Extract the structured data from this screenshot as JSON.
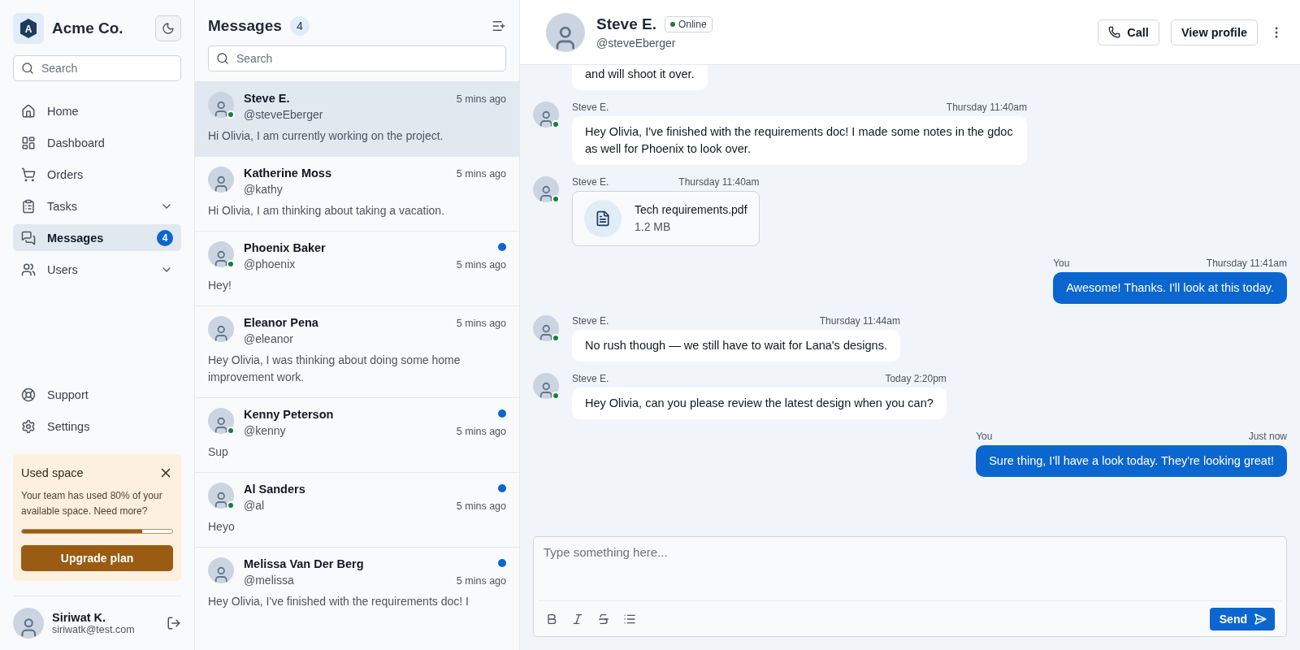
{
  "sidebar": {
    "logo_letter": "A",
    "brand": "Acme Co.",
    "search": {
      "placeholder": "Search"
    },
    "nav": [
      {
        "label": "Home",
        "selected": false
      },
      {
        "label": "Dashboard",
        "selected": false
      },
      {
        "label": "Orders",
        "selected": false
      },
      {
        "label": "Tasks",
        "selected": false,
        "expanded": false
      },
      {
        "label": "Messages",
        "selected": true,
        "badge": "4"
      },
      {
        "label": "Users",
        "selected": false,
        "expanded": false
      }
    ],
    "nav_bottom": [
      {
        "label": "Support",
        "selected": false
      },
      {
        "label": "Settings",
        "selected": false
      }
    ],
    "usage_card": {
      "title": "Used space",
      "text": "Your team has used 80% of your available space. Need more?",
      "level": 0.8,
      "button": "Upgrade plan"
    },
    "user": {
      "name": "Siriwat K.",
      "email": "siriwatk@test.com"
    }
  },
  "message_list": {
    "title": "Messages",
    "count": "4",
    "search": {
      "placeholder": "Search"
    },
    "conversations": [
      {
        "name": "Steve E.",
        "handle": "@steveEberger",
        "time": "5 mins ago",
        "preview": "Hi Olivia, I am currently working on the project.",
        "selected": true,
        "online": true,
        "unread": false
      },
      {
        "name": "Katherine Moss",
        "handle": "@kathy",
        "time": "5 mins ago",
        "preview": "Hi Olivia, I am thinking about taking a vacation.",
        "selected": false,
        "online": false,
        "unread": false
      },
      {
        "name": "Phoenix Baker",
        "handle": "@phoenix",
        "time": "5 mins ago",
        "preview": "Hey!",
        "selected": false,
        "online": true,
        "unread": true
      },
      {
        "name": "Eleanor Pena",
        "handle": "@eleanor",
        "time": "5 mins ago",
        "preview": "Hey Olivia, I was thinking about doing some home improvement work.",
        "selected": false,
        "online": false,
        "unread": false
      },
      {
        "name": "Kenny Peterson",
        "handle": "@kenny",
        "time": "5 mins ago",
        "preview": "Sup",
        "selected": false,
        "online": true,
        "unread": true
      },
      {
        "name": "Al Sanders",
        "handle": "@al",
        "time": "5 mins ago",
        "preview": "Heyo",
        "selected": false,
        "online": true,
        "unread": true
      },
      {
        "name": "Melissa Van Der Berg",
        "handle": "@melissa",
        "time": "5 mins ago",
        "preview": "Hey Olivia, I've finished with the requirements doc! I",
        "selected": false,
        "online": false,
        "unread": true
      }
    ]
  },
  "chat": {
    "contact": {
      "name": "Steve E.",
      "status": "Online",
      "handle": "@steveEberger"
    },
    "buttons": {
      "call": "Call",
      "profile": "View profile"
    },
    "messages": [
      {
        "kind": "text",
        "from_you": false,
        "text": "and will shoot it over."
      },
      {
        "kind": "text",
        "from_you": false,
        "sender": "Steve E.",
        "time": "Thursday 11:40am",
        "text": "Hey Olivia, I've finished with the requirements doc! I made some notes in the gdoc as well for Phoenix to look over."
      },
      {
        "kind": "file",
        "from_you": false,
        "sender": "Steve E.",
        "time": "Thursday 11:40am",
        "file_name": "Tech requirements.pdf",
        "file_size": "1.2 MB"
      },
      {
        "kind": "text",
        "from_you": true,
        "sender": "You",
        "time": "Thursday 11:41am",
        "text": "Awesome! Thanks. I'll look at this today."
      },
      {
        "kind": "text",
        "from_you": false,
        "sender": "Steve E.",
        "time": "Thursday 11:44am",
        "text": "No rush though — we still have to wait for Lana's designs."
      },
      {
        "kind": "text",
        "from_you": false,
        "sender": "Steve E.",
        "time": "Today 2:20pm",
        "text": "Hey Olivia, can you please review the latest design when you can?"
      },
      {
        "kind": "text",
        "from_you": true,
        "sender": "You",
        "time": "Just now",
        "text": "Sure thing, I'll have a look today. They're looking great!"
      }
    ],
    "composer": {
      "placeholder": "Type something here...",
      "send": "Send"
    }
  }
}
